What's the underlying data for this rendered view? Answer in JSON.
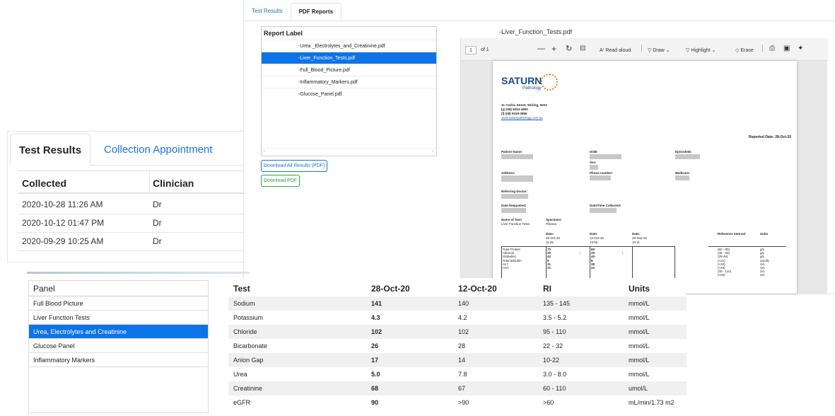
{
  "pdf": {
    "tabs": [
      "Test Results",
      "PDF Reports"
    ],
    "list_header": "Report Label",
    "files": [
      "-Urea _Electrolytes_and_Creatinine.pdf",
      "-Liver_Function_Tests.pdf",
      "-Full_Blood_Picture.pdf",
      "-Inflammatory_Markers.pdf",
      "-Glucose_Panel.pdf"
    ],
    "download_all": "Download All Results (PDF)",
    "download": "Download PDF",
    "viewer_title": "-Liver_Function_Tests.pdf",
    "page_num": "1",
    "page_of": "of 1",
    "toolbar": {
      "read_aloud": "Read aloud",
      "draw": "Draw",
      "highlight": "Highlight",
      "erase": "Erase"
    },
    "doc": {
      "logo": "SATURN",
      "logo_sub": "Pathology",
      "addr1": "31 Cedric Street, Stirling, 6021",
      "addr2": "(p) (08) 9253-4800",
      "addr3": "(f) (08) 9319-3855",
      "web": "www.saturnpathology.com.au",
      "reported": "Reported Date: 28-Oct-20",
      "patient_name": "Patient Name:",
      "dob": "DOB:",
      "episode": "EpisodeID:",
      "sex": "Sex:",
      "address": "Address:",
      "phone": "Phone number:",
      "medicare": "Medicare:",
      "referring": "Referring Doctor:",
      "date_req": "Date Requested:",
      "date_coll": "Date/Time Collected:",
      "name_test": "Name of Test:",
      "name_test_v": "Liver Function Tests",
      "specimen": "Specimen:",
      "specimen_v": "Plasma",
      "date_lbl": "Date:",
      "d1": "28-Oct-20",
      "t1": "11:26",
      "d2": "12-Oct-20",
      "t2": "13:56",
      "d3": "29-Sep-20",
      "t3": "10:11",
      "ref_int": "Reference Interval",
      "units": "Units",
      "tests": [
        "Total Protein",
        "Albumin",
        "Globulins",
        "Total Bilirubin",
        "ALT",
        "AST"
      ],
      "v1": [
        "70",
        "29",
        "42",
        "8",
        "31",
        "21"
      ],
      "v2": [
        "69",
        "29",
        "40",
        "8",
        "28",
        "22"
      ],
      "refs": [
        "(60 - 80)",
        "(35 - 50)",
        "(25-45)",
        "(<21)",
        "(<40)",
        "(<45)",
        "(30 - 110)",
        "(<60)"
      ],
      "u": [
        "g/L",
        "g/L",
        "g/L",
        "umol/L",
        "U/L",
        "U/L",
        "U/L",
        "U/L"
      ]
    }
  },
  "results": {
    "tabs": [
      "Test Results",
      "Collection Appointment"
    ],
    "headers": [
      "Collected",
      "Clinician"
    ],
    "rows": [
      [
        "2020-10-28 11:26 AM",
        "Dr"
      ],
      [
        "2020-10-12 01:47 PM",
        "Dr"
      ],
      [
        "2020-09-29 10:25 AM",
        "Dr"
      ]
    ]
  },
  "panels": {
    "header": "Panel",
    "items": [
      "Full Blood Picture",
      "Liver Function Tests",
      "Urea, Electrolytes and Creatinine",
      "Glucose Panel",
      "Inflammatory Markers"
    ]
  },
  "table": {
    "headers": [
      "Test",
      "28-Oct-20",
      "12-Oct-20",
      "RI",
      "Units"
    ],
    "rows": [
      [
        "Sodium",
        "141",
        "140",
        "135 - 145",
        "mmol/L"
      ],
      [
        "Potassium",
        "4.3",
        "4.2",
        "3.5 - 5.2",
        "mmol/L"
      ],
      [
        "Chloride",
        "102",
        "102",
        "95 - 110",
        "mmol/L"
      ],
      [
        "Bicarbonate",
        "26",
        "28",
        "22 - 32",
        "mmol/L"
      ],
      [
        "Anion Gap",
        "17",
        "14",
        "10-22",
        "mmol/L"
      ],
      [
        "Urea",
        "5.0",
        "7.8",
        "3.0 - 8.0",
        "mmol/L"
      ],
      [
        "Creatinine",
        "68",
        "67",
        "60 - 110",
        "umol/L"
      ],
      [
        "eGFR",
        "90",
        ">90",
        ">60",
        "mL/min/1.73 m2"
      ]
    ]
  },
  "colors": {
    "accent": "#0d73e8",
    "link": "#1a73e8",
    "success": "#28a745"
  }
}
